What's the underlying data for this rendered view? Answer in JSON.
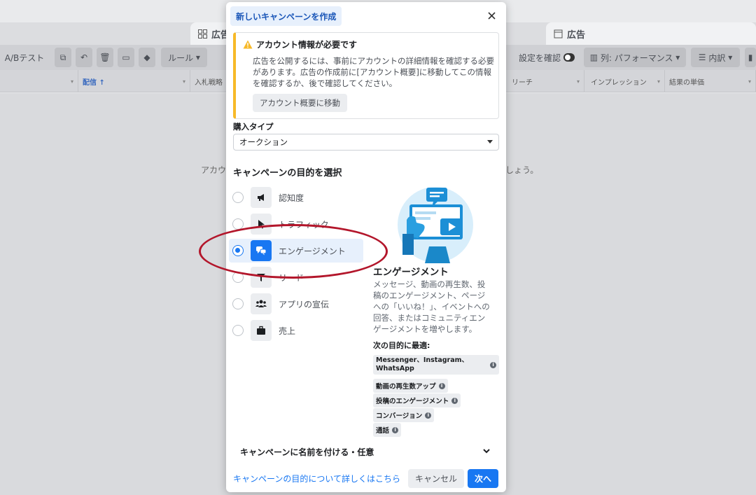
{
  "background": {
    "tabs": [
      {
        "label": "広告",
        "icon": "grid-icon"
      },
      {
        "label": "広告",
        "icon": "document-icon"
      }
    ],
    "toolbar": {
      "ab_test": "A/Bテスト",
      "rules": "ルール",
      "settings_check": "設定を確認",
      "columns": "列: パフォーマンス",
      "breakdown": "内訳"
    },
    "columns": {
      "delivery": "配信 ↑",
      "bid_strategy": "入札戦略",
      "reach": "リーチ",
      "impressions": "インプレッション",
      "cost_per_result": "結果の単価"
    },
    "empty_left": "アカウ",
    "empty_right": "しょう。"
  },
  "modal": {
    "title": "新しいキャンペーンを作成",
    "warning": {
      "title": "アカウント情報が必要です",
      "text": "広告を公開するには、事前にアカウントの詳細情報を確認する必要があります。広告の作成前に[アカウント概要]に移動してこの情報を確認するか、後で確認してください。",
      "button": "アカウント概要に移動"
    },
    "purchase_type": {
      "label": "購入タイプ",
      "value": "オークション"
    },
    "objective_title": "キャンペーンの目的を選択",
    "objectives": [
      {
        "label": "認知度",
        "icon": "megaphone-icon",
        "selected": false
      },
      {
        "label": "トラフィック",
        "icon": "cursor-icon",
        "selected": false
      },
      {
        "label": "エンゲージメント",
        "icon": "chat-bubbles-icon",
        "selected": true
      },
      {
        "label": "リード",
        "icon": "funnel-icon",
        "selected": false
      },
      {
        "label": "アプリの宣伝",
        "icon": "people-icon",
        "selected": false
      },
      {
        "label": "売上",
        "icon": "briefcase-icon",
        "selected": false
      }
    ],
    "detail": {
      "title": "エンゲージメント",
      "description": "メッセージ、動画の再生数、投稿のエンゲージメント、ページへの「いいね！」、イベントへの回答、またはコミュニティエンゲージメントを増やします。",
      "best_for_title": "次の目的に最適:",
      "best_for": [
        "Messenger、Instagram、WhatsApp",
        "動画の再生数アップ",
        "投稿のエンゲージメント",
        "コンバージョン",
        "通話"
      ]
    },
    "name_section": "キャンペーンに名前を付ける・任意",
    "learn_more": "キャンペーンの目的について詳しくはこちら",
    "cancel": "キャンセル",
    "next": "次へ",
    "accent_color": "#1877f2",
    "warning_color": "#f7b928",
    "annotation_color": "#b3162b"
  }
}
